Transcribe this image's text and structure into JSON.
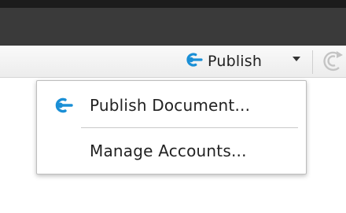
{
  "toolbar": {
    "publish_label": "Publish",
    "publish_icon": "publish-icon",
    "refresh_icon": "refresh-icon"
  },
  "menu": {
    "items": [
      {
        "label": "Publish Document...",
        "icon": "publish-icon"
      },
      {
        "label": "Manage Accounts..."
      }
    ]
  },
  "colors": {
    "accent": "#1a8fd6"
  }
}
